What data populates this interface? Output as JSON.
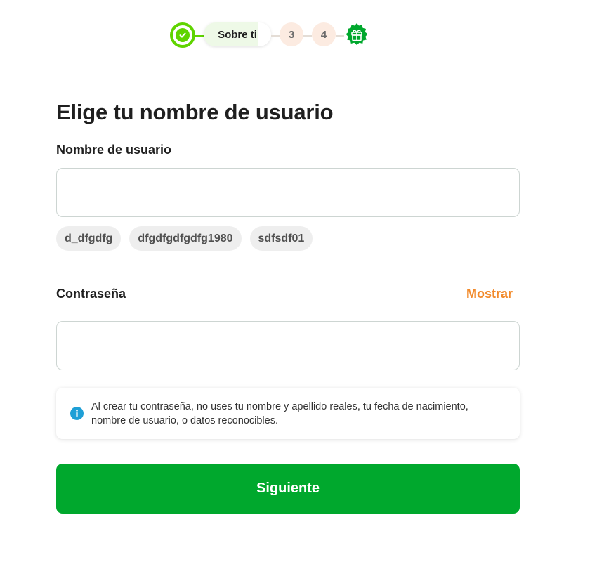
{
  "stepper": {
    "current_step_label": "Sobre ti",
    "steps": [
      "3",
      "4"
    ],
    "progress_fraction": 0.8,
    "colors": {
      "done": "#5fd400",
      "pending": "#fcebe1",
      "gift": "#00a82d"
    }
  },
  "form": {
    "title": "Elige tu nombre de usuario",
    "username": {
      "label": "Nombre de usuario",
      "value": "",
      "suggestions": [
        "d_dfgdfg",
        "dfgdfgdfgdfg1980",
        "sdfsdf01"
      ]
    },
    "password": {
      "label": "Contraseña",
      "value": "",
      "show_label": "Mostrar"
    },
    "hint": "Al crear tu contraseña, no uses tu nombre y apellido reales, tu fecha de nacimiento, nombre de usuario, o datos reconocibles.",
    "submit_label": "Siguiente"
  },
  "colors": {
    "primary": "#00a82d",
    "link": "#f28a2b",
    "info": "#1e9fd6"
  }
}
